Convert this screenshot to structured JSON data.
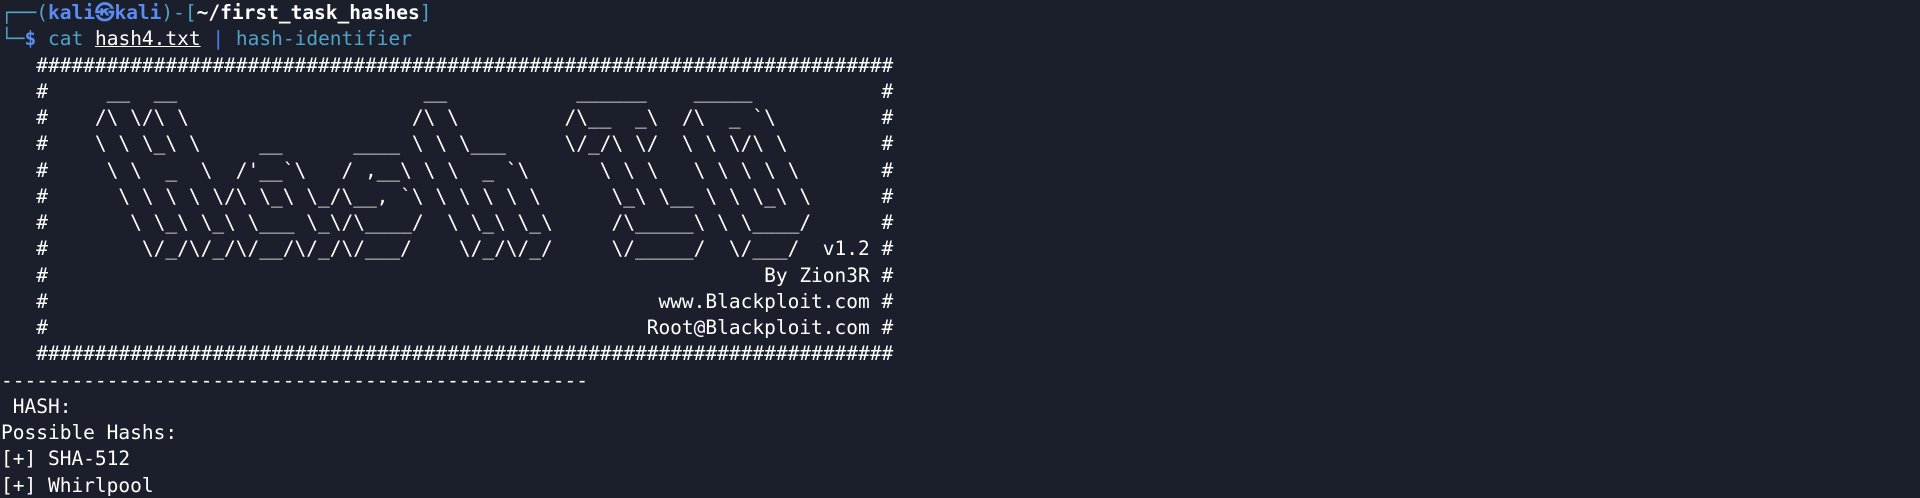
{
  "prompt": {
    "corner_top": "┌──(",
    "user": "kali",
    "at_symbol": "㉿",
    "host": "kali",
    "close_paren": ")-[",
    "path": "~/first_task_hashes",
    "close_bracket": "]",
    "corner_bottom": "└─",
    "dollar": "$",
    "command": "cat",
    "file_arg": "hash4.txt",
    "pipe": "|",
    "pipe_command": "hash-identifier"
  },
  "banner_lines": [
    "   #########################################################################",
    "   #     __  __                     __           ______    _____           #",
    "   #    /\\ \\/\\ \\                   /\\ \\         /\\__  _\\  /\\  _ `\\         #",
    "   #    \\ \\ \\_\\ \\     __      ____ \\ \\ \\___     \\/_/\\ \\/  \\ \\ \\/\\ \\        #",
    "   #     \\ \\  _  \\  /'__`\\   / ,__\\ \\ \\  _ `\\      \\ \\ \\   \\ \\ \\ \\ \\       #",
    "   #      \\ \\ \\ \\ \\/\\ \\_\\ \\_/\\__, `\\ \\ \\ \\ \\ \\      \\_\\ \\__ \\ \\ \\_\\ \\      #",
    "   #       \\ \\_\\ \\_\\ \\___ \\_\\/\\____/  \\ \\_\\ \\_\\     /\\_____\\ \\ \\____/      #",
    "   #        \\/_/\\/_/\\/__/\\/_/\\/___/    \\/_/\\/_/     \\/_____/  \\/___/  v1.2 #",
    "   #                                                             By Zion3R #",
    "   #                                                    www.Blackploit.com #",
    "   #                                                   Root@Blackploit.com #",
    "   #########################################################################"
  ],
  "separator": "--------------------------------------------------",
  "output": {
    "hash_label": " HASH: ",
    "possible_label": "Possible Hashs:",
    "results": [
      "[+] SHA-512",
      "[+] Whirlpool"
    ]
  }
}
